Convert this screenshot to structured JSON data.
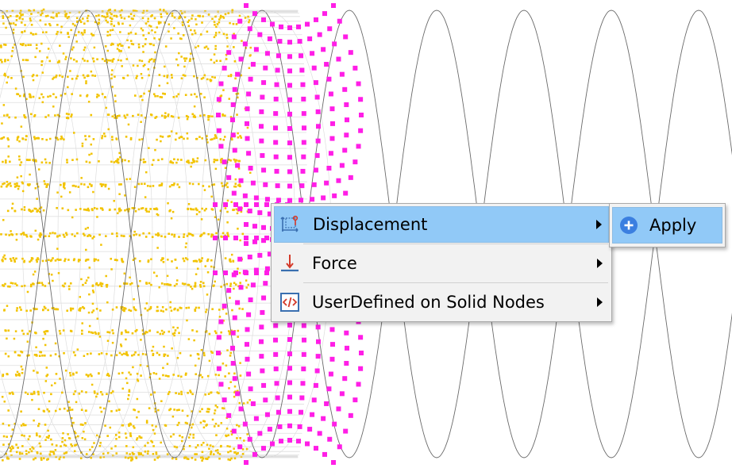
{
  "viewport": {
    "colors": {
      "wire": "#6a6a6a",
      "mesh_lines": "#dedede",
      "interior_nodes": "#f2c300",
      "selected_nodes": "#ff1ee6"
    }
  },
  "context_menu": {
    "items": [
      {
        "label": "Displacement",
        "icon": "displacement-icon",
        "has_submenu": true,
        "highlighted": true
      },
      {
        "label": "Force",
        "icon": "force-icon",
        "has_submenu": true,
        "highlighted": false
      },
      {
        "label": "UserDefined on Solid Nodes",
        "icon": "code-icon",
        "has_submenu": true,
        "highlighted": false
      }
    ]
  },
  "submenu": {
    "items": [
      {
        "label": "Apply",
        "icon": "add-circle-icon",
        "highlighted": true
      }
    ]
  }
}
